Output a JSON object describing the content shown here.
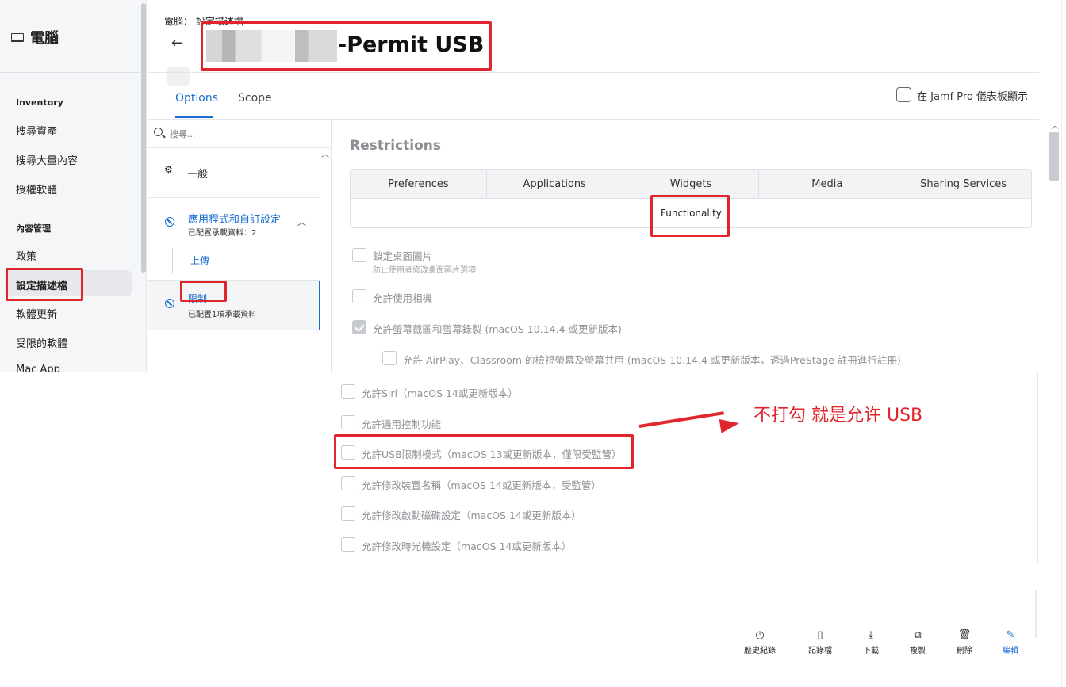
{
  "sidebar": {
    "title": "電腦",
    "sections": [
      {
        "heading": "Inventory",
        "items": [
          "搜尋資產",
          "搜尋大量內容",
          "授權軟體"
        ]
      },
      {
        "heading": "內容管理",
        "items": [
          "政策",
          "設定描述檔",
          "軟體更新",
          "受限的軟體",
          "Mac App"
        ]
      }
    ],
    "active_item": "設定描述檔"
  },
  "header": {
    "breadcrumb": "電腦： 設定描述檔",
    "back_icon": "←",
    "title_suffix": "-Permit USB"
  },
  "tabs": [
    {
      "label": "Options",
      "active": true
    },
    {
      "label": "Scope",
      "active": false
    }
  ],
  "dashboard_toggle": {
    "label": "在 Jamf Pro 儀表板顯示",
    "checked": false
  },
  "payload_list": {
    "search_placeholder": "搜尋...",
    "items": [
      {
        "label": "一般",
        "sub": ""
      },
      {
        "label": "應用程式和自訂設定",
        "sub": "已配置承載資料：2"
      },
      {
        "label": "上傳",
        "sub": ""
      },
      {
        "label": "限制",
        "sub": "已配置1項承載資料"
      }
    ]
  },
  "restrictions": {
    "title": "Restrictions",
    "subtabs": [
      "Preferences",
      "Applications",
      "Widgets",
      "Media",
      "Sharing Services"
    ],
    "active_subtab": "Functionality",
    "options": [
      {
        "label": "鎖定桌面圖片",
        "sub": "防止使用者修改桌面圖片選項",
        "checked": false
      },
      {
        "label": "允許使用相機",
        "checked": false
      },
      {
        "label": "允許螢幕截圖和螢幕錄製 (macOS 10.14.4 或更新版本)",
        "checked": true
      },
      {
        "label": "允許 AirPlay、Classroom 的檢視螢幕及螢幕共用 (macOS 10.14.4 或更新版本，透過PreStage 註冊進行註冊)",
        "checked": false
      },
      {
        "label": "允許Siri（macOS 14或更新版本）",
        "checked": false
      },
      {
        "label": "允許通用控制功能",
        "checked": false
      },
      {
        "label": "允許USB限制模式（macOS 13或更新版本，僅限受監管）",
        "checked": false
      },
      {
        "label": "允許修改裝置名稱（macOS 14或更新版本，受監管）",
        "checked": false
      },
      {
        "label": "允許修改啟動磁碟設定（macOS 14或更新版本）",
        "checked": false
      },
      {
        "label": "允許修改時光機設定（macOS 14或更新版本）",
        "checked": false
      }
    ]
  },
  "annotation": {
    "text": "不打勾 就是允许 USB",
    "color": "#e0262c"
  },
  "toolbar": {
    "history": "歷史紀錄",
    "logs": "記錄檔",
    "download": "下載",
    "copy": "複製",
    "delete": "刪除",
    "edit": "編輯"
  },
  "colors": {
    "accent": "#1a6dd1",
    "annotation_red": "#e0262c"
  }
}
